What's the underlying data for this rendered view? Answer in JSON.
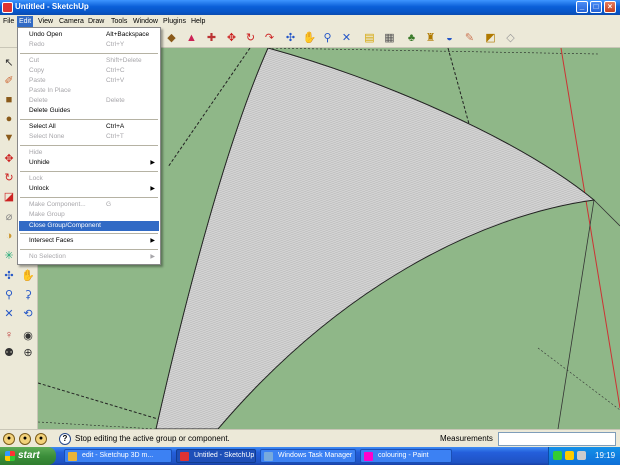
{
  "window": {
    "title": "Untitled - SketchUp"
  },
  "menubar": [
    "File",
    "Edit",
    "View",
    "Camera",
    "Draw",
    "Tools",
    "Window",
    "Plugins",
    "Help"
  ],
  "edit_menu": {
    "items": [
      {
        "label": "Undo Open",
        "shortcut": "Alt+Backspace",
        "disabled": false,
        "submenu": false
      },
      {
        "label": "Redo",
        "shortcut": "Ctrl+Y",
        "disabled": true,
        "submenu": false
      },
      {
        "label": "Cut",
        "shortcut": "Shift+Delete",
        "disabled": true,
        "submenu": false
      },
      {
        "label": "Copy",
        "shortcut": "Ctrl+C",
        "disabled": true,
        "submenu": false
      },
      {
        "label": "Paste",
        "shortcut": "Ctrl+V",
        "disabled": true,
        "submenu": false
      },
      {
        "label": "Paste In Place",
        "shortcut": "",
        "disabled": true,
        "submenu": false
      },
      {
        "label": "Delete",
        "shortcut": "Delete",
        "disabled": true,
        "submenu": false
      },
      {
        "label": "Delete Guides",
        "shortcut": "",
        "disabled": false,
        "submenu": false
      },
      {
        "label": "Select All",
        "shortcut": "Ctrl+A",
        "disabled": false,
        "submenu": false
      },
      {
        "label": "Select None",
        "shortcut": "Ctrl+T",
        "disabled": true,
        "submenu": false
      },
      {
        "label": "Hide",
        "shortcut": "",
        "disabled": true,
        "submenu": false
      },
      {
        "label": "Unhide",
        "shortcut": "",
        "disabled": false,
        "submenu": true
      },
      {
        "label": "Lock",
        "shortcut": "",
        "disabled": true,
        "submenu": false
      },
      {
        "label": "Unlock",
        "shortcut": "",
        "disabled": false,
        "submenu": true
      },
      {
        "label": "Make Component...",
        "shortcut": "G",
        "disabled": true,
        "submenu": false
      },
      {
        "label": "Make Group",
        "shortcut": "",
        "disabled": true,
        "submenu": false
      },
      {
        "label": "Close Group/Component",
        "shortcut": "",
        "disabled": false,
        "submenu": false,
        "highlighted": true
      },
      {
        "label": "Intersect Faces",
        "shortcut": "",
        "disabled": false,
        "submenu": true
      },
      {
        "label": "No Selection",
        "shortcut": "",
        "disabled": true,
        "submenu": true
      }
    ]
  },
  "status": {
    "message": "Stop editing the active group or component.",
    "measurements_label": "Measurements",
    "measurements_value": ""
  },
  "taskbar": {
    "start_label": "start",
    "buttons": [
      {
        "label": "edit - Sketchup 3D m...",
        "active": false
      },
      {
        "label": "Untitled - SketchUp",
        "active": true
      },
      {
        "label": "Windows Task Manager",
        "active": false
      },
      {
        "label": "colouring - Paint",
        "active": false
      }
    ],
    "clock": "19:19"
  },
  "colors": {
    "canvas_bg": "#8fb788",
    "face_fill": "#c9c9c9",
    "menu_highlight": "#316ac5",
    "red_axis": "#c33",
    "taskbar_blue": "#245edb"
  },
  "icons": {
    "toolbar": [
      "component-icon",
      "paint-bucket-icon",
      "push-pull-icon",
      "move-icon",
      "rotate-icon",
      "follow-me-icon",
      "orbit-icon",
      "pan-icon",
      "zoom-icon",
      "zoom-extents-icon",
      "warehouse-icon",
      "component-browser-icon",
      "materials-icon",
      "styles-icon",
      "layers-icon",
      "shadows-icon",
      "section-icon"
    ],
    "left": [
      "select-icon",
      "eraser-icon",
      "paint-icon",
      "line-icon",
      "rectangle-icon",
      "circle-icon",
      "polygon-icon",
      "arc-icon",
      "move-icon",
      "push-pull-icon",
      "rotate-icon",
      "follow-me-icon",
      "scale-icon",
      "offset-icon",
      "tape-icon",
      "dimension-icon",
      "protractor-icon",
      "text-icon",
      "axes-icon",
      "3d-text-icon",
      "orbit-icon",
      "pan-icon",
      "zoom-icon",
      "zoom-window-icon",
      "zoom-extents-icon",
      "previous-icon",
      "position-camera-icon",
      "look-around-icon",
      "walk-icon",
      "section-plane-icon"
    ]
  }
}
